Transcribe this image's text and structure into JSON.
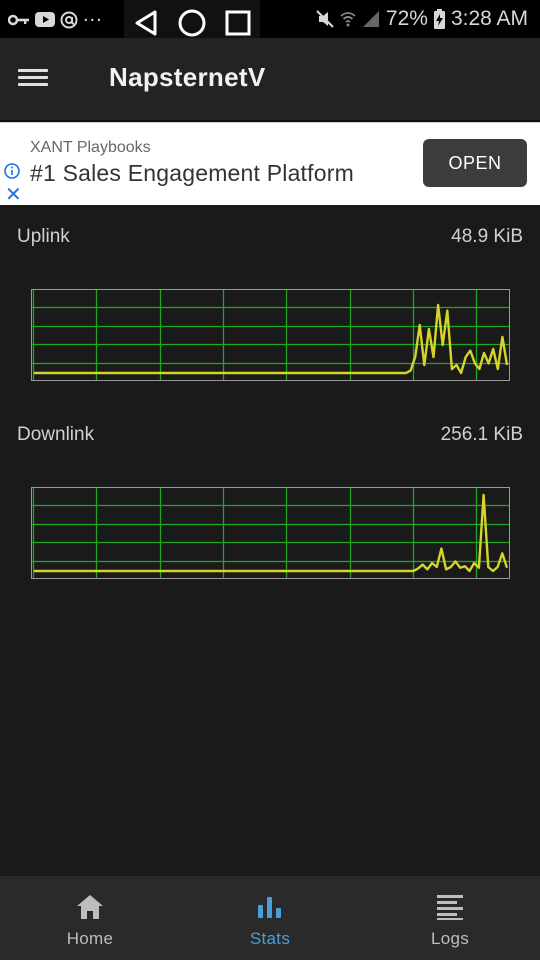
{
  "status_bar": {
    "left_dots": "...",
    "battery_percent": "72%",
    "time": "3:28 AM"
  },
  "app_bar": {
    "title": "NapsternetV"
  },
  "ad": {
    "advertiser": "XANT Playbooks",
    "headline": "#1 Sales Engagement Platform",
    "cta": "OPEN"
  },
  "stats": {
    "uplink": {
      "label": "Uplink",
      "value": "48.9 KiB",
      "samples": [
        0,
        0,
        0,
        0,
        0,
        0,
        0,
        0,
        0,
        0,
        0,
        0,
        0,
        0,
        0,
        0,
        0,
        0,
        0,
        0,
        0,
        0,
        0,
        0,
        0,
        0,
        0,
        0,
        0,
        0,
        0,
        0,
        0,
        0,
        0,
        0,
        0,
        0,
        0,
        0,
        0,
        0,
        0,
        0,
        0,
        0,
        0,
        0,
        0,
        0,
        0,
        0,
        0,
        0,
        0,
        0,
        0,
        0,
        0,
        0,
        0,
        0,
        0,
        0,
        0,
        0,
        0,
        0,
        0,
        0,
        0,
        0,
        0,
        0,
        0,
        0,
        0,
        0,
        0,
        0,
        0,
        0,
        0.03,
        0.2,
        0.6,
        0.1,
        0.55,
        0.2,
        0.85,
        0.35,
        0.78,
        0.05,
        0.1,
        0,
        0.2,
        0.28,
        0.12,
        0.05,
        0.25,
        0.12,
        0.3,
        0.05,
        0.45,
        0.1
      ]
    },
    "downlink": {
      "label": "Downlink",
      "value": "256.1 KiB",
      "samples": [
        0,
        0,
        0,
        0,
        0,
        0,
        0,
        0,
        0,
        0,
        0,
        0,
        0,
        0,
        0,
        0,
        0,
        0,
        0,
        0,
        0,
        0,
        0,
        0,
        0,
        0,
        0,
        0,
        0,
        0,
        0,
        0,
        0,
        0,
        0,
        0,
        0,
        0,
        0,
        0,
        0,
        0,
        0,
        0,
        0,
        0,
        0,
        0,
        0,
        0,
        0,
        0,
        0,
        0,
        0,
        0,
        0,
        0,
        0,
        0,
        0,
        0,
        0,
        0,
        0,
        0,
        0,
        0,
        0,
        0,
        0,
        0,
        0,
        0,
        0,
        0,
        0,
        0,
        0,
        0,
        0,
        0,
        0.03,
        0.08,
        0.02,
        0.1,
        0.05,
        0.28,
        0.02,
        0.05,
        0.12,
        0.04,
        0.06,
        0,
        0.1,
        0.04,
        0.95,
        0.05,
        0.0,
        0.05,
        0.22,
        0.04
      ]
    },
    "line_color": "#d4d42a",
    "grid_color": "#1fa81f"
  },
  "bottom_nav": {
    "items": [
      {
        "label": "Home",
        "icon": "home-icon",
        "active": false
      },
      {
        "label": "Stats",
        "icon": "stats-icon",
        "active": true
      },
      {
        "label": "Logs",
        "icon": "logs-icon",
        "active": false
      }
    ],
    "active_color": "#4a9fd8"
  }
}
